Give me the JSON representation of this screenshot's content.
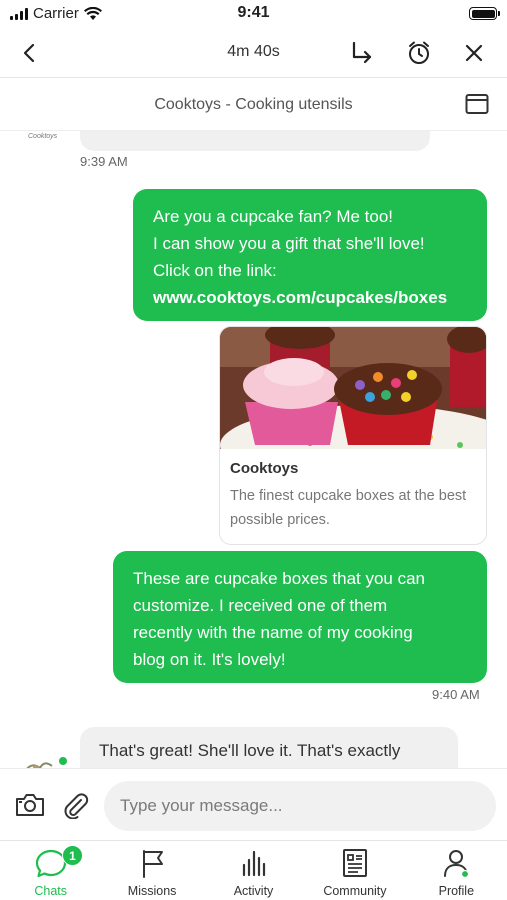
{
  "status_bar": {
    "carrier": "Carrier",
    "time": "9:41"
  },
  "nav": {
    "timer": "4m 40s"
  },
  "subheader": {
    "title": "Cooktoys - Cooking utensils"
  },
  "messages": {
    "partial_logo": "Cooktoys",
    "first_time": "9:39 AM",
    "out1": {
      "line1": "Are you a cupcake fan? Me too!",
      "line2": "I can show you a gift that she'll love!",
      "line3": "Click on the link:",
      "link": "www.cooktoys.com/cupcakes/boxes"
    },
    "card": {
      "title": "Cooktoys",
      "description": "The finest cupcake boxes at the best possible prices."
    },
    "out2": {
      "line1": "These are cupcake boxes that you can",
      "line2": "customize. I received one of them",
      "line3": "recently with the name of my cooking",
      "line4": "blog on it. It's lovely!"
    },
    "second_time": "9:40 AM",
    "in_text": "That's great! She'll love it. That's exactly"
  },
  "composer": {
    "placeholder": "Type your message..."
  },
  "tabs": [
    {
      "label": "Chats",
      "icon": "chat-bubble-icon",
      "badge": "1",
      "active": true
    },
    {
      "label": "Missions",
      "icon": "flag-icon"
    },
    {
      "label": "Activity",
      "icon": "bar-chart-icon"
    },
    {
      "label": "Community",
      "icon": "newspaper-icon"
    },
    {
      "label": "Profile",
      "icon": "person-icon"
    }
  ],
  "colors": {
    "accent": "#1fbc4f",
    "bubble_in": "#f0f0f0"
  }
}
